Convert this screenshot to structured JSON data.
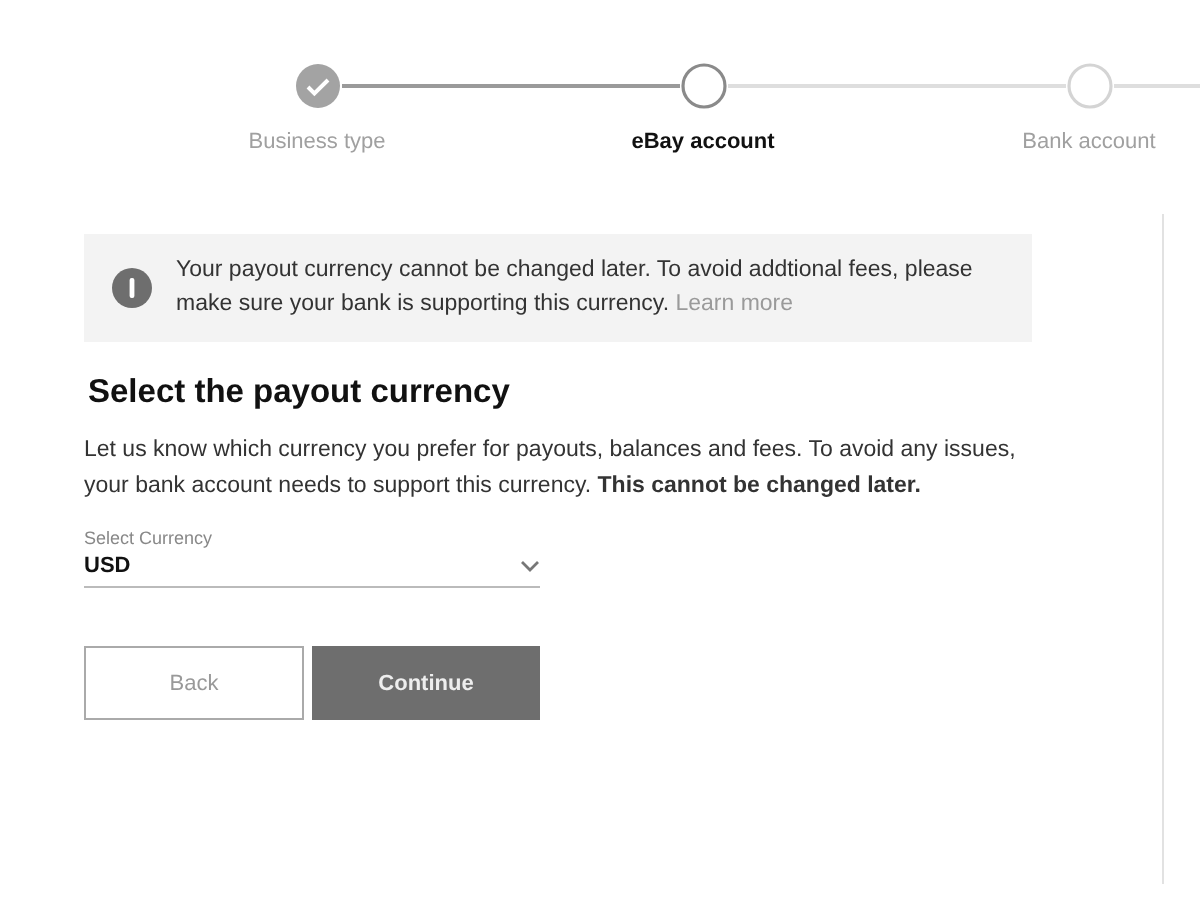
{
  "stepper": [
    {
      "label": "Business type",
      "completed": true,
      "selected": false
    },
    {
      "label": "eBay account",
      "completed": false,
      "selected": true
    },
    {
      "label": "Bank account",
      "completed": false,
      "selected": false
    }
  ],
  "notice": {
    "text": "Your payout currency cannot be changed later. To avoid addtional fees, please make sure your bank is supporting this currency.",
    "link": "Learn more"
  },
  "heading": "Select the payout currency",
  "description": "Let us know which currency you prefer for payouts, balances and fees. To avoid any issues, your bank account needs to support this currency. **This cannot be changed later.**",
  "currency_select": {
    "label": "Select Currency",
    "value": "USD"
  },
  "buttons": [
    {
      "label": "Back",
      "kind": "secondary"
    },
    {
      "label": "Continue",
      "kind": "primary"
    }
  ]
}
